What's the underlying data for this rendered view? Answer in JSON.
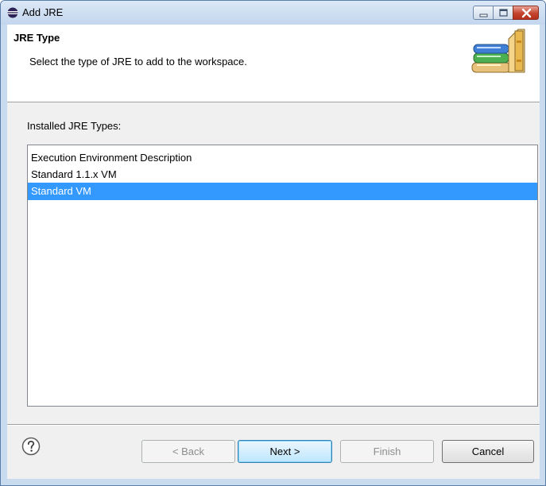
{
  "window": {
    "title": "Add JRE"
  },
  "header": {
    "title": "JRE Type",
    "description": "Select the type of JRE to add to the workspace."
  },
  "main": {
    "list_label": "Installed JRE Types:",
    "jre_types": [
      {
        "label": "Execution Environment Description",
        "selected": false
      },
      {
        "label": "Standard 1.1.x VM",
        "selected": false
      },
      {
        "label": "Standard VM",
        "selected": true
      }
    ]
  },
  "buttons": {
    "help_icon": "question-mark-icon",
    "back": "< Back",
    "next": "Next >",
    "finish": "Finish",
    "cancel": "Cancel"
  },
  "colors": {
    "selection": "#3399ff",
    "window_frame": "#c9dbef",
    "close_button": "#c3442e"
  }
}
